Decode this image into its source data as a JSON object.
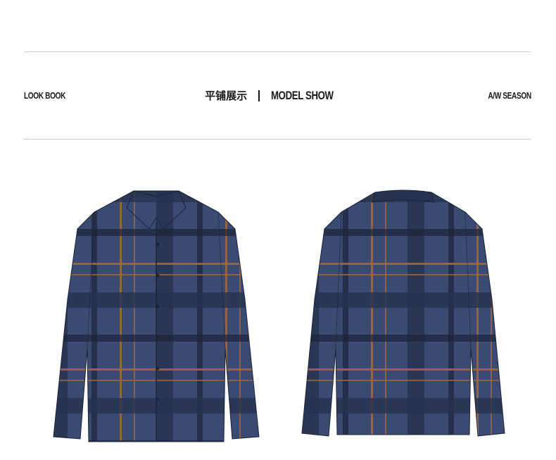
{
  "header": {
    "left_label": "LOOK BOOK",
    "center_cn": "平铺展示",
    "center_en": "MODEL SHOW",
    "right_label": "A/W SEASON"
  },
  "products": [
    {
      "view": "front"
    },
    {
      "view": "back"
    }
  ],
  "colors": {
    "plaid_base": "#3a4a72",
    "plaid_dark": "#1c2438",
    "plaid_accent": "#a0683a",
    "rule": "#c9c9c9"
  }
}
